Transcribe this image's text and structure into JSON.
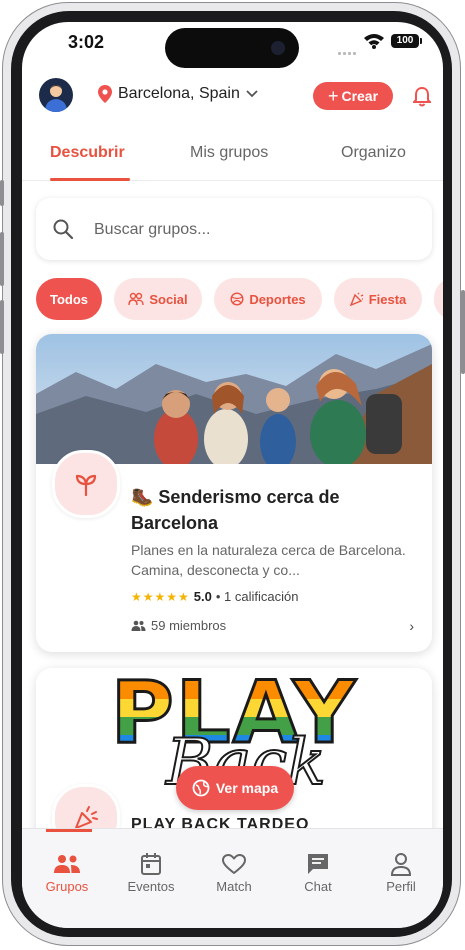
{
  "status_bar": {
    "time": "3:02",
    "battery": "100"
  },
  "header": {
    "location": "Barcelona, Spain",
    "create_button": "Crear"
  },
  "tabs": [
    {
      "label": "Descubrir",
      "active": true
    },
    {
      "label": "Mis grupos",
      "active": false
    },
    {
      "label": "Organizo",
      "active": false
    }
  ],
  "search": {
    "placeholder": "Buscar grupos..."
  },
  "chips": [
    {
      "label": "Todos",
      "icon": "none",
      "active": true
    },
    {
      "label": "Social",
      "icon": "people-icon",
      "active": false
    },
    {
      "label": "Deportes",
      "icon": "ball-icon",
      "active": false
    },
    {
      "label": "Fiesta",
      "icon": "party-icon",
      "active": false
    }
  ],
  "groups": [
    {
      "title": "🥾 Senderismo cerca de Barcelona",
      "description": "Planes en la naturaleza cerca de Barcelona. Camina, desconecta y co...",
      "rating_value": "5.0",
      "rating_text": "• 1 calificación",
      "members": "59 miembros",
      "icon": "sprout-icon",
      "stars": 5
    },
    {
      "title": "PLAY BACK TARDEO",
      "art_word_top": "PLAY",
      "art_word_script": "Back",
      "icon": "party-popper-icon"
    }
  ],
  "map_button": "Ver mapa",
  "bottom_nav": [
    {
      "label": "Grupos",
      "icon": "groups-icon",
      "active": true
    },
    {
      "label": "Eventos",
      "icon": "calendar-icon",
      "active": false
    },
    {
      "label": "Match",
      "icon": "heart-icon",
      "active": false
    },
    {
      "label": "Chat",
      "icon": "chat-icon",
      "active": false
    },
    {
      "label": "Perfil",
      "icon": "person-icon",
      "active": false
    }
  ],
  "colors": {
    "accent": "#ef5350",
    "accent_text": "#e8523f",
    "chip_bg": "#fbe4e3",
    "star": "#f5b400"
  }
}
